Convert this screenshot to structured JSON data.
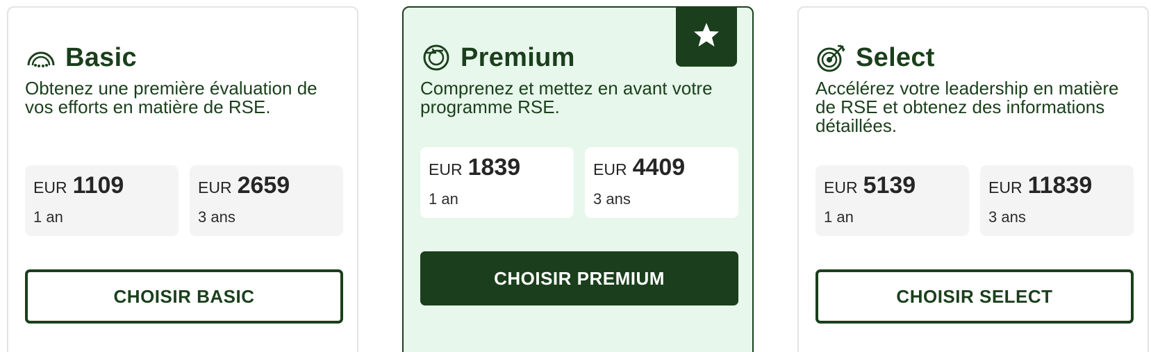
{
  "colors": {
    "brand": "#1b3f1c",
    "premium_bg": "#e7f7eb",
    "price_box_bg": "#f4f4f4"
  },
  "plans": [
    {
      "name": "Basic",
      "icon": "gauge-icon",
      "description": "Obtenez une première évaluation de vos efforts en matière de RSE.",
      "prices": [
        {
          "currency": "EUR",
          "amount": "1109",
          "period": "1 an"
        },
        {
          "currency": "EUR",
          "amount": "2659",
          "period": "3 ans"
        }
      ],
      "button_label": "CHOISIR BASIC"
    },
    {
      "name": "Premium",
      "icon": "cycle-arrow-icon",
      "badge_icon": "star-icon",
      "description": "Comprenez et mettez en avant votre programme RSE.",
      "prices": [
        {
          "currency": "EUR",
          "amount": "1839",
          "period": "1 an"
        },
        {
          "currency": "EUR",
          "amount": "4409",
          "period": "3 ans"
        }
      ],
      "button_label": "CHOISIR PREMIUM"
    },
    {
      "name": "Select",
      "icon": "target-arrow-icon",
      "description": "Accélérez votre leadership en matière de RSE et obtenez des informations détaillées.",
      "prices": [
        {
          "currency": "EUR",
          "amount": "5139",
          "period": "1 an"
        },
        {
          "currency": "EUR",
          "amount": "11839",
          "period": "3 ans"
        }
      ],
      "button_label": "CHOISIR SELECT"
    }
  ]
}
